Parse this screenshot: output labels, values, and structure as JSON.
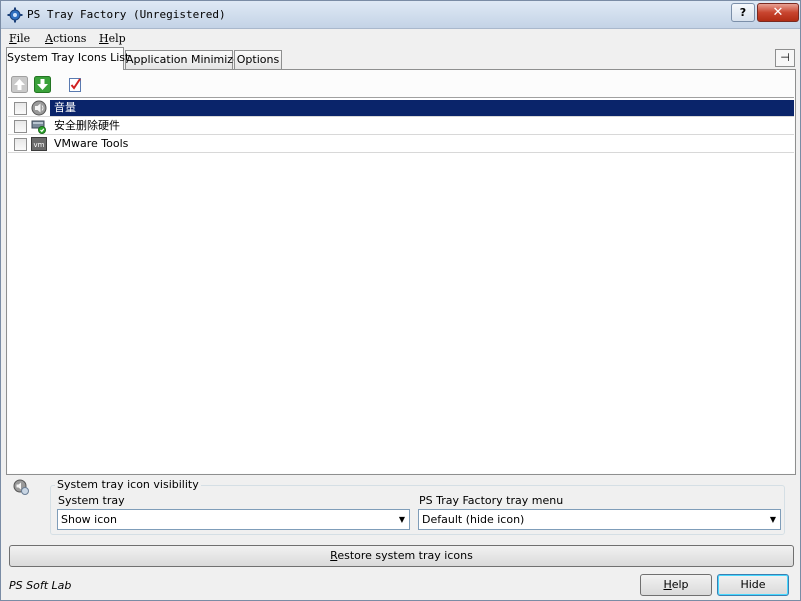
{
  "window": {
    "title": "PS Tray Factory (Unregistered)",
    "help_button": "?",
    "close_button": "✕"
  },
  "menu": [
    {
      "key": "F",
      "rest": "ile"
    },
    {
      "key": "A",
      "rest": "ctions"
    },
    {
      "key": "H",
      "rest": "elp"
    }
  ],
  "tabs": [
    {
      "label": "System Tray Icons List",
      "active": true
    },
    {
      "label": "Application Minimizer",
      "active": false
    },
    {
      "label": "Options",
      "active": false
    }
  ],
  "pin_icon": "⊣",
  "toolbar": [
    "move-up-icon",
    "move-down-icon",
    "check-all-icon"
  ],
  "tray_items": [
    {
      "label": "音量",
      "icon": "speaker-icon",
      "checked": false,
      "selected": true
    },
    {
      "label": "安全删除硬件",
      "icon": "safely-remove-hardware-icon",
      "checked": false,
      "selected": false
    },
    {
      "label": "VMware Tools",
      "icon": "vmware-icon",
      "checked": false,
      "selected": false
    }
  ],
  "visibility": {
    "group_title": "System tray icon visibility",
    "system_tray_label": "System tray",
    "system_tray_value": "Show icon",
    "factory_menu_label": "PS Tray Factory tray menu",
    "factory_menu_value": "Default (hide icon)"
  },
  "restore_button": {
    "key": "R",
    "rest": "estore system tray icons"
  },
  "status": {
    "company": "PS Soft Lab"
  },
  "buttons": {
    "help": {
      "key": "H",
      "rest": "elp"
    },
    "hide": {
      "key": "",
      "rest": "Hide"
    }
  }
}
